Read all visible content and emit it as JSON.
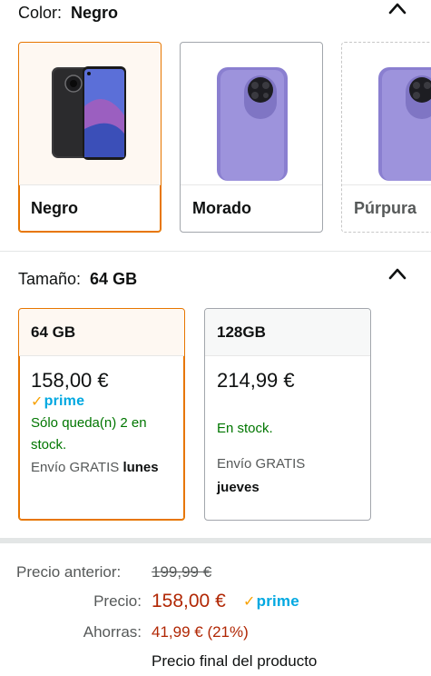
{
  "color_section": {
    "label": "Color:",
    "value": "Negro",
    "options": [
      {
        "label": "Negro",
        "selected": true
      },
      {
        "label": "Morado",
        "selected": false
      },
      {
        "label": "Púrpura",
        "selected": false
      }
    ]
  },
  "size_section": {
    "label": "Tamaño:",
    "value": "64 GB",
    "options": [
      {
        "label": "64 GB",
        "price": "158,00 €",
        "prime": "prime",
        "stock_line1": "Sólo queda(n) 2 en",
        "stock_line2": "stock.",
        "ship_prefix": "Envío GRATIS",
        "ship_day": "lunes",
        "selected": true
      },
      {
        "label": "128GB",
        "price": "214,99 €",
        "stock": "En stock.",
        "ship_prefix": "Envío GRATIS",
        "ship_day": "jueves",
        "selected": false
      }
    ]
  },
  "price_block": {
    "previous_label": "Precio anterior:",
    "previous_value": "199,99 €",
    "price_label": "Precio:",
    "price_value": "158,00 €",
    "prime": "prime",
    "savings_label": "Ahorras:",
    "savings_value": "41,99 € (21%)",
    "final_note": "Precio final del producto"
  },
  "colors": {
    "accent_orange": "#e77600",
    "selected_bg": "#fef8f2",
    "price_red": "#b12704",
    "stock_green": "#007600",
    "prime_blue": "#00a8e1",
    "prime_check": "#f7a100",
    "phone_purple": "#8a7fd0"
  }
}
